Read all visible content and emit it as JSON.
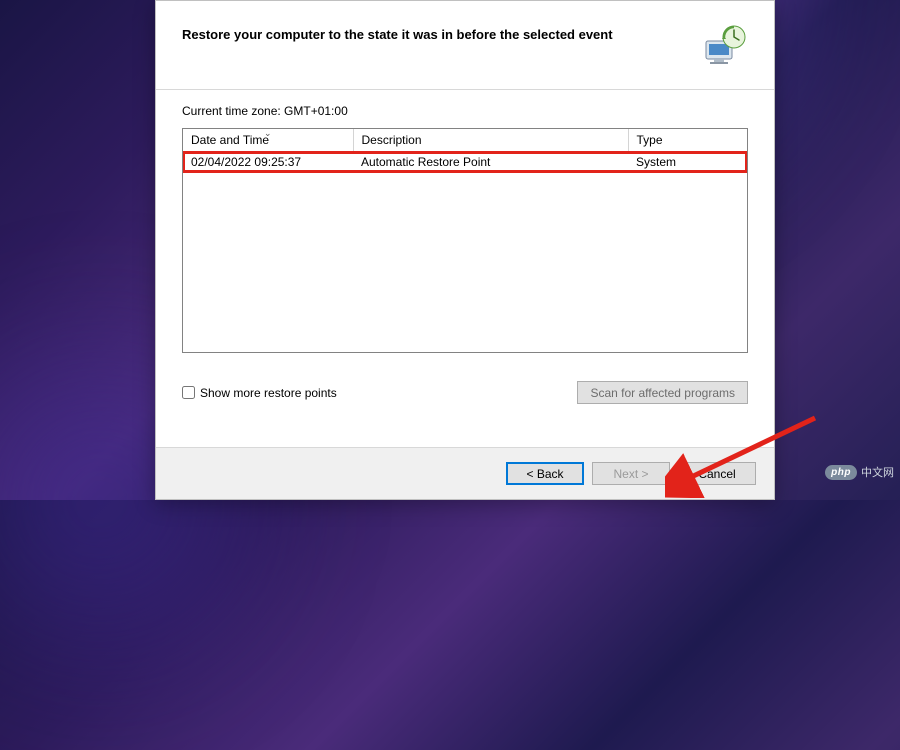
{
  "header": {
    "title": "Restore your computer to the state it was in before the selected event"
  },
  "timezone": {
    "label": "Current time zone: GMT+01:00"
  },
  "table": {
    "columns": {
      "date": "Date and Time",
      "desc": "Description",
      "type": "Type"
    },
    "rows": [
      {
        "date": "02/04/2022 09:25:37",
        "desc": "Automatic Restore Point",
        "type": "System"
      }
    ]
  },
  "options": {
    "show_more_label": "Show more restore points",
    "scan_label": "Scan for affected programs"
  },
  "footer": {
    "back": "< Back",
    "next": "Next >",
    "cancel": "Cancel"
  },
  "watermark": {
    "badge": "php",
    "text": "中文网"
  }
}
